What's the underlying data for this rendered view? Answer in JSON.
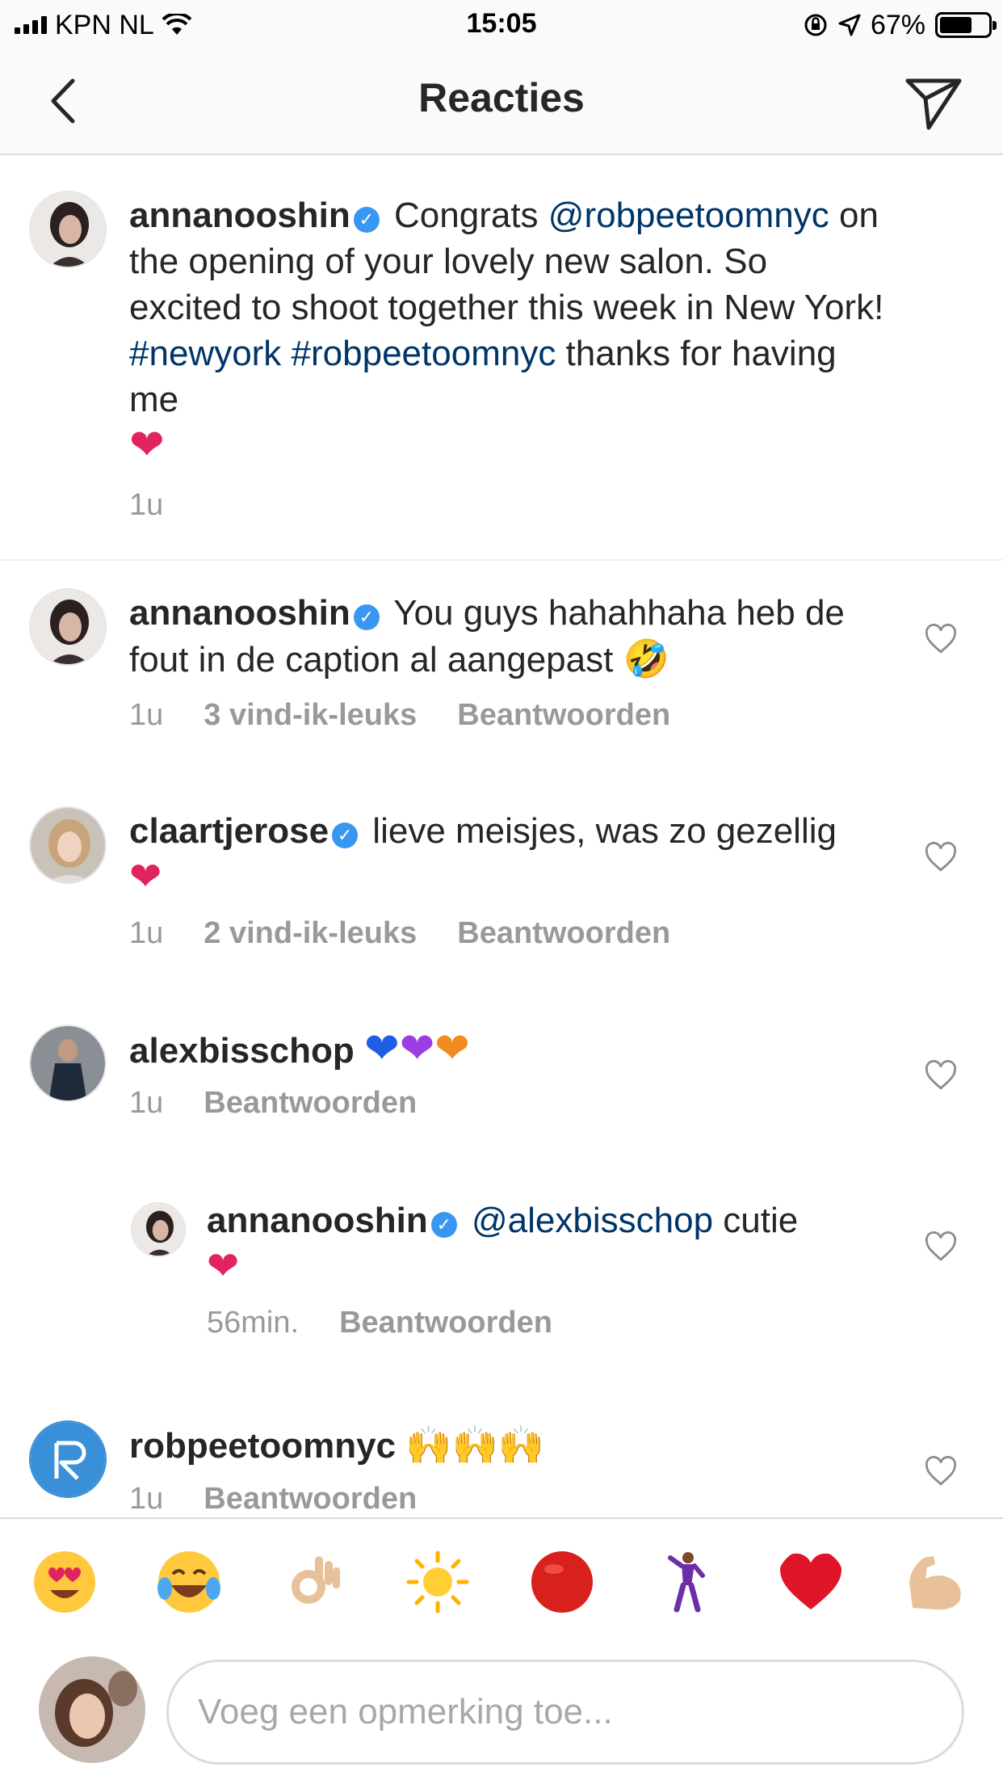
{
  "status_bar": {
    "carrier": "KPN NL",
    "time": "15:05",
    "battery": "67%",
    "battery_level": 0.67
  },
  "nav": {
    "title": "Reacties",
    "back_icon": "chevron-left-icon",
    "send_icon": "paper-plane-icon"
  },
  "caption": {
    "username": "annanooshin",
    "text_pre": "Congrats",
    "mention": "@robpeetoomnyc",
    "text_mid": "on the opening of your lovely new salon. So excited to shoot together this week in New York!",
    "hashtag1": "#newyork",
    "hashtag2": "#robpeetoomnyc",
    "text_post": "thanks for having me",
    "time": "1u"
  },
  "comments": [
    {
      "username": "annanooshin",
      "text": "You guys hahahhaha heb de fout in de caption al aangepast",
      "time": "1u",
      "likes": "3 vind-ik-leuks",
      "reply": "Beantwoorden"
    },
    {
      "username": "claartjerose",
      "text": "lieve meisjes, was zo gezellig",
      "time": "1u",
      "likes": "2 vind-ik-leuks",
      "reply": "Beantwoorden"
    },
    {
      "username": "alexbisschop",
      "text": "",
      "time": "1u",
      "reply": "Beantwoorden"
    },
    {
      "username": "annanooshin",
      "mention": "@alexbisschop",
      "text": "cutie",
      "time": "56min.",
      "reply": "Beantwoorden"
    },
    {
      "username": "robpeetoomnyc",
      "text": "",
      "time": "1u",
      "reply": "Beantwoorden"
    }
  ],
  "emoji_bar": [
    "heart-eyes-emoji",
    "tears-of-joy-emoji",
    "ok-hand-emoji",
    "sun-emoji",
    "red-circle-emoji",
    "dancer-emoji",
    "red-heart-emoji",
    "flexed-biceps-emoji"
  ],
  "input": {
    "placeholder": "Voeg een opmerking toe..."
  },
  "colors": {
    "link": "#003569",
    "verified": "#3897f0",
    "meta": "#999999",
    "heart": "#e0245e"
  }
}
